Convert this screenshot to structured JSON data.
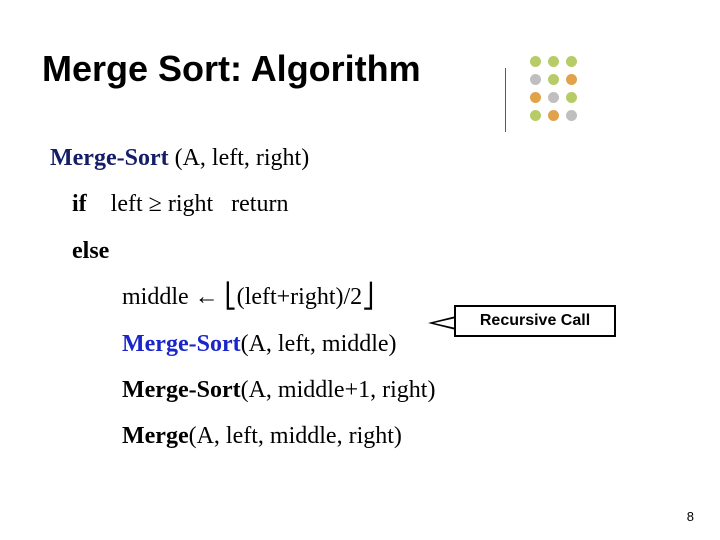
{
  "title": "Merge Sort: Algorithm",
  "algo": {
    "header_name": "Merge-Sort",
    "header_args": " (A, left, right)",
    "if": "if",
    "if_cond": "left ≥ right",
    "return": "return",
    "else": "else",
    "assign": "middle ← ⎣(left+right)/2⎦",
    "call1_name": "Merge-Sort",
    "call1_args": "(A, left, middle)",
    "call2_name": "Merge-Sort",
    "call2_args": "(A, middle+1, right)",
    "call3_name": "Merge",
    "call3_args": "(A, left, middle, right)"
  },
  "callout": "Recursive Call",
  "page_number": "8",
  "deco_colors": {
    "green": "#b7cc66",
    "orange": "#e2a24a",
    "grey": "#bfbfbf"
  }
}
